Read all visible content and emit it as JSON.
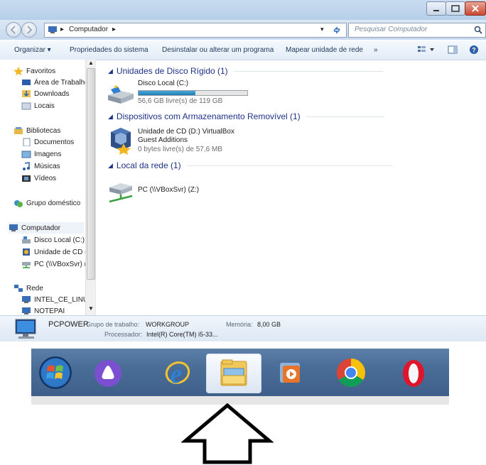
{
  "window": {
    "address_path": "Computador",
    "search_placeholder": "Pesquisar Computador"
  },
  "toolbar": {
    "organize": "Organizar ▾",
    "system_properties": "Propriedades do sistema",
    "uninstall": "Desinstalar ou alterar um programa",
    "map_drive": "Mapear unidade de rede",
    "more": "»"
  },
  "sidebar": {
    "favorites": "Favoritos",
    "desktop": "Área de Trabalho",
    "downloads": "Downloads",
    "locais": "Locais",
    "libraries": "Bibliotecas",
    "documents": "Documentos",
    "images": "Imagens",
    "music": "Músicas",
    "videos": "Vídeos",
    "homegroup": "Grupo doméstico",
    "computer": "Computador",
    "local_disk": "Disco Local (C:)",
    "cd_drive": "Unidade de CD (I",
    "pc_share": "PC (\\\\VBoxSvr) (Z",
    "network": "Rede",
    "net1": "INTEL_CE_LINUX",
    "net2": "NOTEPAI"
  },
  "main": {
    "hdd_group": "Unidades de Disco Rígido (1)",
    "disk_c_name": "Disco Local (C:)",
    "disk_c_free": "56,6 GB livre(s) de 119 GB",
    "disk_c_used_fraction": 0.52,
    "removable_group": "Dispositivos com Armazenamento Removível (1)",
    "cd_name": "Unidade de CD (D:) VirtualBox",
    "cd_label": "Guest Additions",
    "cd_free": "0 bytes livre(s) de 57,6 MB",
    "network_group": "Local da rede (1)",
    "pc_share_name": "PC (\\\\VBoxSvr) (Z:)"
  },
  "details": {
    "computer_name": "PCPOWER",
    "workgroup_label": "Grupo de trabalho:",
    "workgroup": "WORKGROUP",
    "memory_label": "Memória:",
    "memory": "8,00 GB",
    "processor_label": "Processador:",
    "processor": "Intel(R) Core(TM) i5-33..."
  },
  "taskbar": {
    "icons": [
      "windows-start-icon",
      "app-triangle-icon",
      "internet-explorer-icon",
      "file-explorer-icon",
      "media-player-icon",
      "chrome-icon",
      "opera-icon"
    ]
  },
  "colors": {
    "accent": "#1e3287",
    "taskbar": "#4a6d98",
    "disk_fill": "#2a8fc7"
  }
}
